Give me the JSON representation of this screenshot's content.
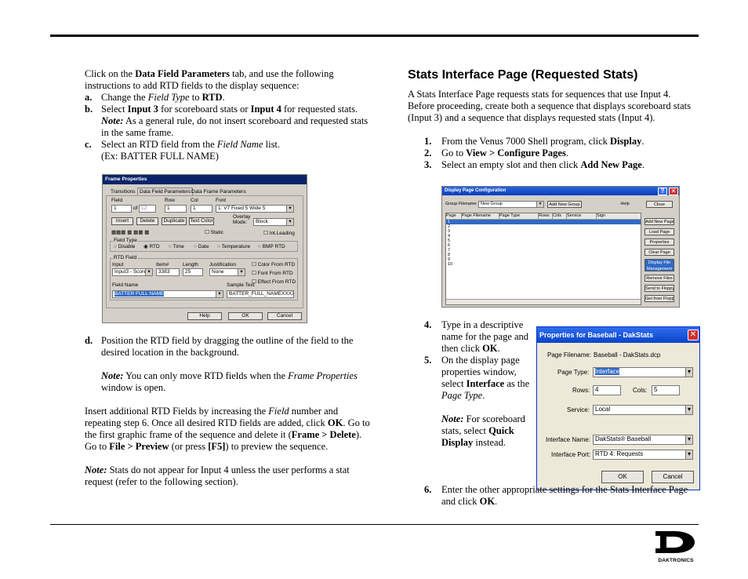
{
  "left": {
    "intro": [
      "Click on the ",
      "Data Field Parameters",
      " tab, and use the following instructions to add RTD fields to the display sequence:"
    ],
    "step_a": {
      "label": "a.",
      "pre": "Change the ",
      "em": "Field Type",
      "mid": " to ",
      "bold": "RTD",
      "post": "."
    },
    "step_b": {
      "label": "b.",
      "pre": "Select ",
      "b1": "Input 3",
      "mid": " for scoreboard stats or ",
      "b2": "Input 4",
      "post": " for requested stats.",
      "note_label": "Note:",
      "note": " As a general rule, do not insert scoreboard and requested stats in the same frame."
    },
    "step_c": {
      "label": "c.",
      "pre": "Select an RTD field from the ",
      "em": "Field Name",
      "post": " list.",
      "example": "(Ex: BATTER FULL NAME)"
    },
    "step_d": {
      "label": "d.",
      "text": "Position the RTD field by dragging the outline of the field to the desired location in the background.",
      "note_label": "Note:",
      "note_pre": " You can only move RTD fields when the ",
      "note_em": "Frame Properties",
      "note_post": " window is open."
    },
    "para1": {
      "t1": "Insert additional RTD Fields by increasing the ",
      "em": "Field",
      "t2": " number and repeating step 6. Once all desired RTD fields are added, click ",
      "b1": "OK",
      "t3": ". Go to the first graphic frame of the sequence and delete it (",
      "b2": "Frame > Delete",
      "t4": ")."
    },
    "para2": {
      "t1": "Go to ",
      "b1": "File > Preview",
      "t2": " (or press ",
      "b2": "[F5]",
      "t3": ") to preview the sequence."
    },
    "para3": {
      "note_label": "Note:",
      "text": " Stats do not appear for Input 4 unless the user performs a stat request (refer to the following section)."
    }
  },
  "right": {
    "heading": "Stats Interface Page (Requested Stats)",
    "intro": "A Stats Interface Page requests stats for sequences that use Input 4. Before proceeding, create both a sequence that displays scoreboard stats (Input 3) and a sequence that displays requested stats (Input 4).",
    "steps": [
      {
        "num": "1.",
        "pre": "From the Venus 7000 Shell program, click ",
        "bold": "Display",
        "post": "."
      },
      {
        "num": "2.",
        "pre": "Go to ",
        "bold": "View > Configure Pages",
        "post": "."
      },
      {
        "num": "3.",
        "pre": "Select an empty slot and then click ",
        "bold": "Add New Page",
        "post": "."
      }
    ],
    "step4": {
      "num": "4.",
      "pre": "Type in a descriptive name for the page and then click ",
      "bold": "OK",
      "post": "."
    },
    "step5": {
      "num": "5.",
      "pre": "On the display page properties window, select ",
      "bold": "Interface",
      "mid": " as the ",
      "em": "Page Type",
      "post": ".",
      "note_label": "Note:",
      "note_pre": " For scoreboard stats, select ",
      "note_bold": "Quick Display",
      "note_post": " instead."
    },
    "step6": {
      "num": "6.",
      "pre": "Enter the other appropriate settings for the Stats Interface Page and click ",
      "bold": "OK",
      "post": "."
    }
  },
  "frame_dialog": {
    "title": "Frame Properties",
    "tabs": [
      "Transitions",
      "Data Field Parameters",
      "Data Frame Parameters"
    ],
    "field_label": "Field",
    "field_value": "1",
    "of_label": "of",
    "of_value": "12",
    "row_label": "Row",
    "row_value": "1",
    "col_label": "Col",
    "col_value": "1",
    "font_label": "Font",
    "font_value": "1: V7 Fixed 5 Wide 5",
    "buttons_row": [
      "Insert",
      "Delete",
      "Duplicate",
      "Text Color"
    ],
    "overlay_label": "Overlay Mode:",
    "overlay_value": "Block",
    "static_label": "Static",
    "intleading_label": "Int.Leading",
    "field_type_label": "Field Type",
    "field_types": [
      "Disable",
      "RTD",
      "Time",
      "Date",
      "Temperature",
      "BMP RTD"
    ],
    "selected_field_type": "RTD",
    "rtd_group_label": "RTD Field",
    "input_label": "Input",
    "input_value": "Input3 - Score",
    "item_label": "Item#",
    "item_value": "3383",
    "length_label": "Length",
    "length_value": "25",
    "just_label": "Justification",
    "just_value": "None",
    "color_rtd": "Color From RTD",
    "font_rtd": "Font From RTD",
    "effect_rtd": "Effect From RTD",
    "fieldname_label": "Field Name",
    "fieldname_value": "BATTER FULL NAME",
    "sample_label": "Sample Text",
    "sample_value": "BATTER_FULL_NAMEXXXX",
    "footer_buttons": [
      "Help",
      "OK",
      "Cancel"
    ]
  },
  "config_dialog": {
    "title": "Display Page Configuration",
    "group_label": "Group Filename:",
    "group_value": "New Group",
    "add_group": "Add New Group",
    "help": "Help",
    "close": "Close",
    "columns": [
      "Page",
      "Page Filename",
      "Page Type",
      "Rows",
      "Cols",
      "Service",
      "Sign"
    ],
    "rows": [
      "1",
      "2",
      "3",
      "4",
      "5",
      "6",
      "7",
      "8",
      "9",
      "10"
    ],
    "side_buttons": [
      "Add New Page",
      "Load Page",
      "Properties",
      "Clear Page",
      "Display File Management",
      "Remove Files",
      "Send to Floppy",
      "Get from Floppy"
    ]
  },
  "props_dialog": {
    "title": "Properties for Baseball - DakStats",
    "filename_label": "Page Filename:",
    "filename_value": "Baseball - DakStats.dcp",
    "type_label": "Page Type:",
    "type_value": "Interface",
    "rows_label": "Rows:",
    "rows_value": "4",
    "cols_label": "Cols:",
    "cols_value": "5",
    "service_label": "Service:",
    "service_value": "Local",
    "iname_label": "Interface Name:",
    "iname_value": "DakStats® Baseball",
    "iport_label": "Interface Port:",
    "iport_value": "RTD 4: Requests",
    "ok": "OK",
    "cancel": "Cancel"
  },
  "logo_text": "DAKTRONICS",
  "colors": {
    "title_blue": "#0a246a",
    "select_blue": "#316ac5",
    "xp_blue": "#0055e5"
  }
}
